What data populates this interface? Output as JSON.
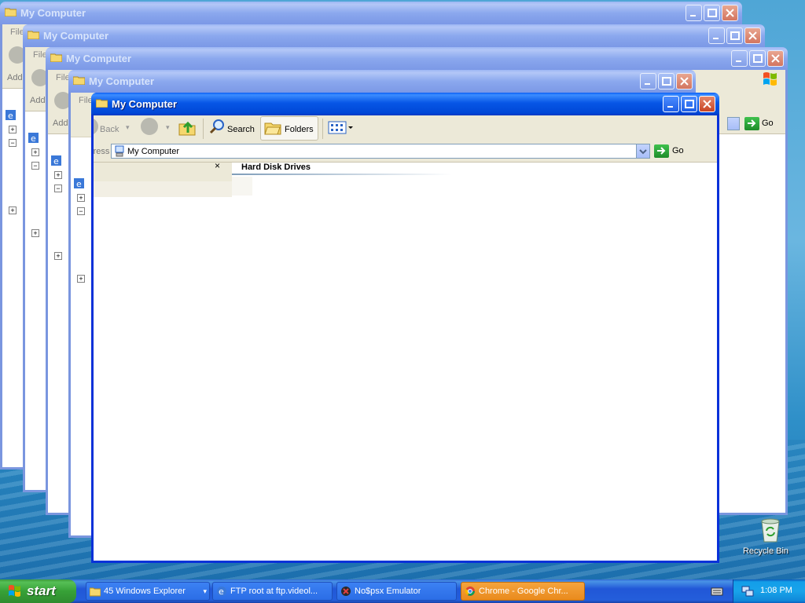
{
  "window_title": "My Computer",
  "back_windows": [
    {
      "title": "My Computer",
      "menu_label": "File",
      "address_label": "Add"
    },
    {
      "title": "My Computer",
      "menu_label": "File",
      "address_label": "Add"
    },
    {
      "title": "My Computer",
      "menu_label": "File",
      "address_label": "Add"
    },
    {
      "title": "My Computer",
      "menu_label": "File",
      "address_label": "Add"
    }
  ],
  "front_window": {
    "title": "My Computer",
    "toolbar": {
      "back": "Back",
      "search": "Search",
      "folders": "Folders"
    },
    "address_label": "Address",
    "address_value": "My Computer",
    "go_label": "Go",
    "section_header": "Hard Disk Drives"
  },
  "right_window": {
    "go_label": "Go"
  },
  "desktop": {
    "recycle_bin": "Recycle Bin"
  },
  "taskbar": {
    "start": "start",
    "tasks": [
      {
        "label": "45 Windows Explorer",
        "icon": "folder-icon",
        "active": false
      },
      {
        "label": "FTP root at ftp.videol...",
        "icon": "ie-icon",
        "active": false
      },
      {
        "label": "No$psx Emulator",
        "icon": "psx-icon",
        "active": false
      },
      {
        "label": "Chrome - Google Chr...",
        "icon": "chrome-icon",
        "active": true
      }
    ],
    "clock": "1:08 PM"
  },
  "colors": {
    "xp_blue": "#0831d9",
    "start_green": "#37a137",
    "active_task": "#e98a1d"
  }
}
